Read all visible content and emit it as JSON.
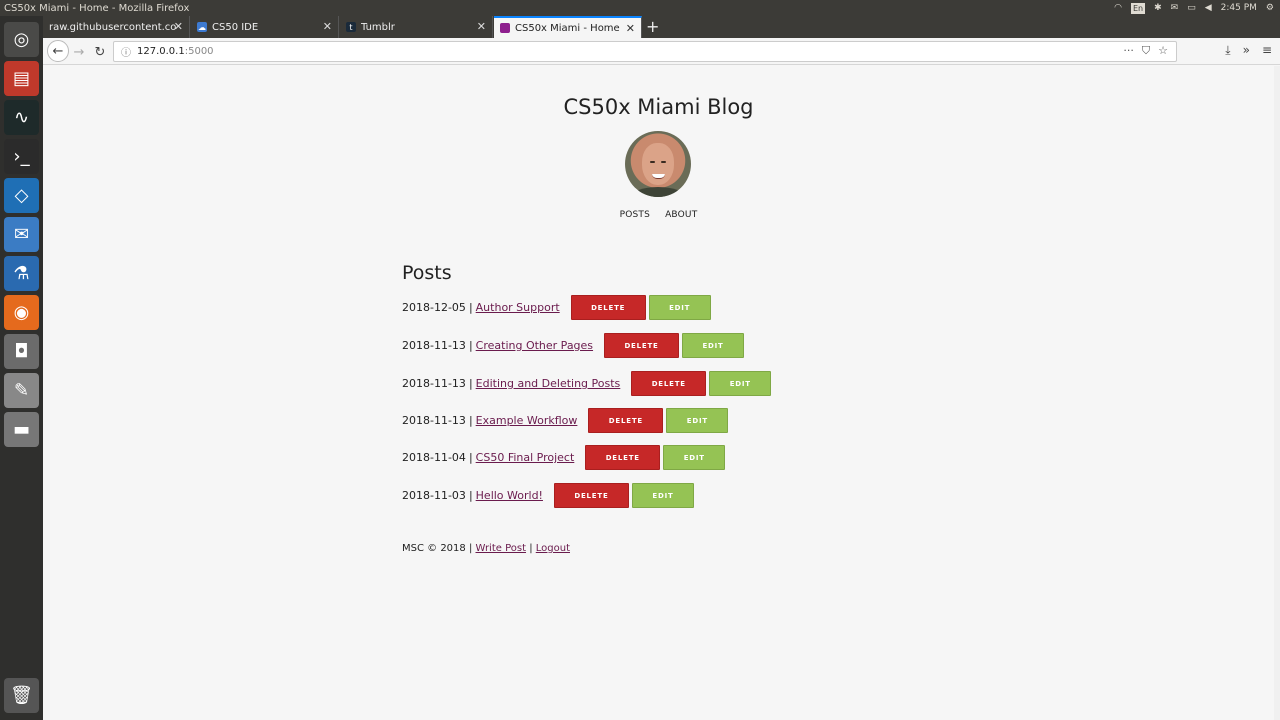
{
  "window": {
    "title": "CS50x Miami - Home - Mozilla Firefox"
  },
  "tray": {
    "lang": "En",
    "time": "2:45 PM"
  },
  "tabs": [
    {
      "label": "raw.githubusercontent.co",
      "favicon": ""
    },
    {
      "label": "CS50 IDE",
      "favicon": "cloud9-icon"
    },
    {
      "label": "Tumblr",
      "favicon": "t"
    },
    {
      "label": "CS50x Miami - Home",
      "favicon": ""
    }
  ],
  "url": {
    "host": "127.0.0.1",
    "port": ":5000"
  },
  "blog": {
    "title": "CS50x Miami Blog",
    "nav": {
      "posts": "POSTS",
      "about": "ABOUT"
    },
    "posts_heading": "Posts",
    "delete_label": "DELETE",
    "edit_label": "EDIT",
    "posts": [
      {
        "date": "2018-12-05",
        "title": "Author Support"
      },
      {
        "date": "2018-11-13",
        "title": "Creating Other Pages"
      },
      {
        "date": "2018-11-13",
        "title": "Editing and Deleting Posts"
      },
      {
        "date": "2018-11-13",
        "title": "Example Workflow"
      },
      {
        "date": "2018-11-04",
        "title": "CS50 Final Project"
      },
      {
        "date": "2018-11-03",
        "title": "Hello World!"
      }
    ],
    "footer": {
      "copyright": "MSC © 2018",
      "write_post": "Write Post",
      "logout": "Logout"
    }
  },
  "colors": {
    "delete": "#c62828",
    "edit": "#95c354",
    "link": "#6a1b4d"
  }
}
